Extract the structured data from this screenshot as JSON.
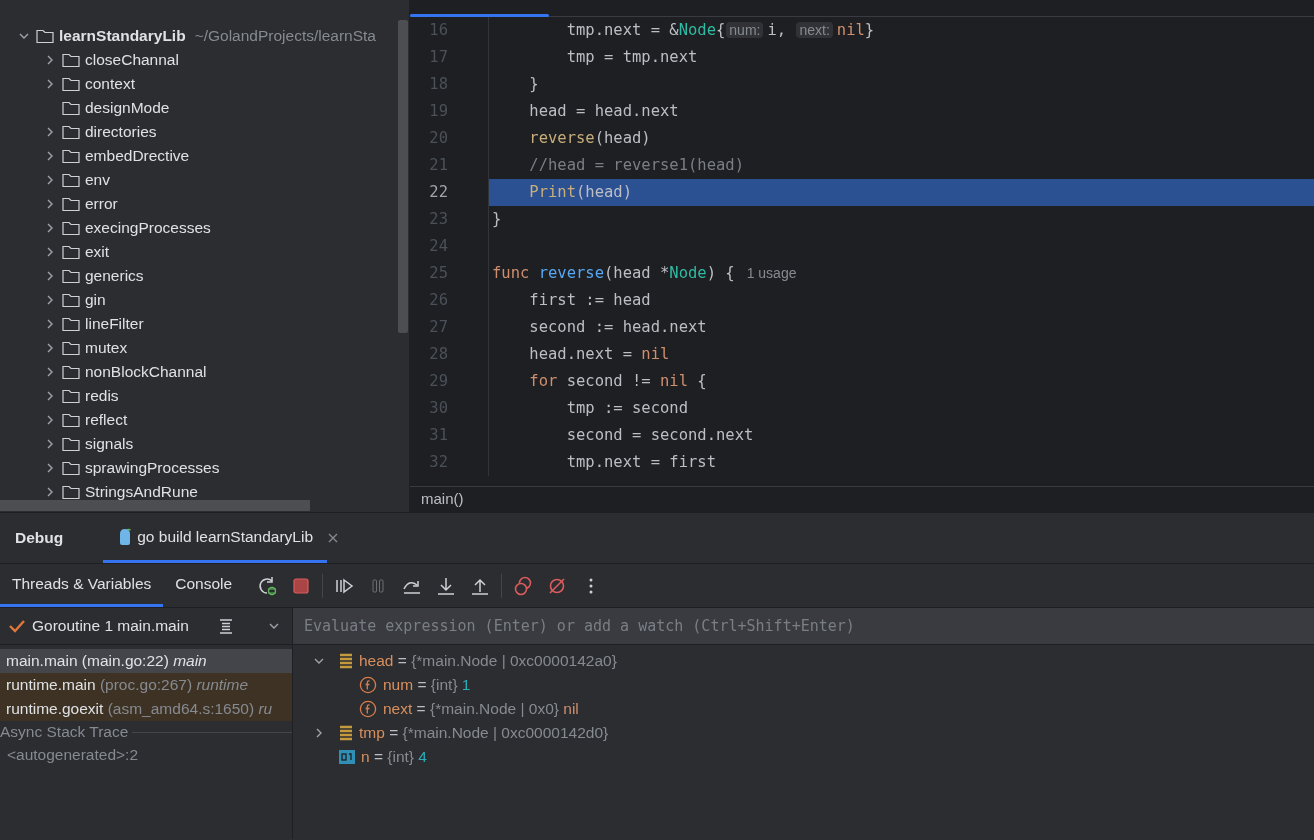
{
  "project_tree": {
    "root": {
      "name": "learnStandaryLib",
      "path": "~/GolandProjects/learnSta",
      "expanded": true,
      "children": [
        {
          "name": "closeChannal",
          "expandable": true
        },
        {
          "name": "context",
          "expandable": true
        },
        {
          "name": "designMode",
          "expandable": false
        },
        {
          "name": "directories",
          "expandable": true
        },
        {
          "name": "embedDrective",
          "expandable": true
        },
        {
          "name": "env",
          "expandable": true
        },
        {
          "name": "error",
          "expandable": true
        },
        {
          "name": "execingProcesses",
          "expandable": true
        },
        {
          "name": "exit",
          "expandable": true
        },
        {
          "name": "generics",
          "expandable": true
        },
        {
          "name": "gin",
          "expandable": true
        },
        {
          "name": "lineFilter",
          "expandable": true
        },
        {
          "name": "mutex",
          "expandable": true
        },
        {
          "name": "nonBlockChannal",
          "expandable": true
        },
        {
          "name": "redis",
          "expandable": true
        },
        {
          "name": "reflect",
          "expandable": true
        },
        {
          "name": "signals",
          "expandable": true
        },
        {
          "name": "sprawingProcesses",
          "expandable": true
        },
        {
          "name": "StringsAndRune",
          "expandable": true
        }
      ]
    }
  },
  "editor": {
    "lines": [
      {
        "number": "16",
        "current": false,
        "tokens": [
          {
            "kind": "plain",
            "text": "        tmp.next = &"
          },
          {
            "kind": "type",
            "text": "Node"
          },
          {
            "kind": "plain",
            "text": "{"
          },
          {
            "kind": "hint",
            "text": "num:"
          },
          {
            "kind": "plain",
            "text": "i, "
          },
          {
            "kind": "hint",
            "text": "next:"
          },
          {
            "kind": "keyword",
            "text": "nil"
          },
          {
            "kind": "plain",
            "text": "}"
          }
        ]
      },
      {
        "number": "17",
        "current": false,
        "tokens": [
          {
            "kind": "plain",
            "text": "        tmp = tmp.next"
          }
        ]
      },
      {
        "number": "18",
        "current": false,
        "tokens": [
          {
            "kind": "plain",
            "text": "    }"
          }
        ]
      },
      {
        "number": "19",
        "current": false,
        "tokens": [
          {
            "kind": "plain",
            "text": "    head = head.next"
          }
        ]
      },
      {
        "number": "20",
        "current": false,
        "tokens": [
          {
            "kind": "call",
            "text": "    reverse"
          },
          {
            "kind": "plain",
            "text": "(head)"
          }
        ]
      },
      {
        "number": "21",
        "current": false,
        "tokens": [
          {
            "kind": "comment",
            "text": "    //head = reverse1(head)"
          }
        ]
      },
      {
        "number": "22",
        "current": true,
        "tokens": [
          {
            "kind": "call",
            "text": "    Print"
          },
          {
            "kind": "plain",
            "text": "(head)"
          }
        ]
      },
      {
        "number": "23",
        "current": false,
        "tokens": [
          {
            "kind": "plain",
            "text": "}"
          }
        ]
      },
      {
        "number": "24",
        "current": false
      },
      {
        "number": "25",
        "current": false,
        "tokens": [
          {
            "kind": "keyword",
            "text": "func "
          },
          {
            "kind": "function",
            "text": "reverse"
          },
          {
            "kind": "plain",
            "text": "(head *"
          },
          {
            "kind": "type",
            "text": "Node"
          },
          {
            "kind": "plain",
            "text": ") {"
          },
          {
            "kind": "usage",
            "text": "1 usage"
          }
        ]
      },
      {
        "number": "26",
        "current": false,
        "tokens": [
          {
            "kind": "plain",
            "text": "    first := head"
          }
        ]
      },
      {
        "number": "27",
        "current": false,
        "tokens": [
          {
            "kind": "plain",
            "text": "    second := head.next"
          }
        ]
      },
      {
        "number": "28",
        "current": false,
        "tokens": [
          {
            "kind": "plain",
            "text": "    head.next = "
          },
          {
            "kind": "keyword",
            "text": "nil"
          }
        ]
      },
      {
        "number": "29",
        "current": false,
        "tokens": [
          {
            "kind": "keyword",
            "text": "    for"
          },
          {
            "kind": "plain",
            "text": " second != "
          },
          {
            "kind": "keyword",
            "text": "nil"
          },
          {
            "kind": "plain",
            "text": " {"
          }
        ]
      },
      {
        "number": "30",
        "current": false,
        "tokens": [
          {
            "kind": "plain",
            "text": "        tmp := second"
          }
        ]
      },
      {
        "number": "31",
        "current": false,
        "tokens": [
          {
            "kind": "plain",
            "text": "        second = second.next"
          }
        ]
      },
      {
        "number": "32",
        "current": false,
        "tokens": [
          {
            "kind": "plain",
            "text": "        tmp.next = first"
          }
        ]
      }
    ],
    "breadcrumb": "main()"
  },
  "debug": {
    "title": "Debug",
    "tabs": [
      {
        "label": "go build learnStandaryLib",
        "selected": true
      }
    ],
    "subtabs": [
      {
        "label": "Threads & Variables",
        "selected": true
      },
      {
        "label": "Console",
        "selected": false
      }
    ],
    "toolbar": [
      {
        "kind": "rerun",
        "disabled": false
      },
      {
        "kind": "stop",
        "disabled": false
      },
      {
        "kind": "separator"
      },
      {
        "kind": "resume",
        "disabled": false
      },
      {
        "kind": "pause",
        "disabled": true
      },
      {
        "kind": "step-over",
        "disabled": false
      },
      {
        "kind": "step-into",
        "disabled": false
      },
      {
        "kind": "step-out",
        "disabled": false
      },
      {
        "kind": "separator"
      },
      {
        "kind": "breakpoints",
        "disabled": false
      },
      {
        "kind": "mute",
        "disabled": false
      },
      {
        "kind": "more",
        "disabled": false
      }
    ],
    "goroutine": "Goroutine 1 main.main",
    "frames": [
      {
        "function": "main.main",
        "location": "(main.go:22)",
        "package": "main",
        "selected": true,
        "library": false
      },
      {
        "function": "runtime.main",
        "location": "(proc.go:267)",
        "package": "runtime",
        "selected": false,
        "library": true
      },
      {
        "function": "runtime.goexit",
        "location": "(asm_amd64.s:1650)",
        "package": "ru",
        "selected": false,
        "library": true
      }
    ],
    "async_label": "Async Stack Trace",
    "async_frames": [
      "<autogenerated>:2"
    ],
    "evaluate": {
      "placeholder": "Evaluate expression (Enter) or add a watch (Ctrl+Shift+Enter)"
    },
    "variables": [
      {
        "kind": "struct",
        "name": "head",
        "operator": "=",
        "type": "{*main.Node | 0xc0000142a0}",
        "expanded": true,
        "children": [
          {
            "kind": "field",
            "name": "num",
            "operator": "=",
            "type": "{int}",
            "value": "1",
            "color": "#2aacb8"
          },
          {
            "kind": "field",
            "name": "next",
            "operator": "=",
            "type": "{*main.Node | 0x0}",
            "value": "nil",
            "color": "#cf8e6d"
          }
        ]
      },
      {
        "kind": "struct",
        "name": "tmp",
        "operator": "=",
        "type": "{*main.Node | 0xc0000142d0}",
        "expanded": false
      },
      {
        "kind": "int",
        "name": "n",
        "operator": "=",
        "type": "{int}",
        "value": "4",
        "color": "#2aacb8"
      }
    ]
  }
}
